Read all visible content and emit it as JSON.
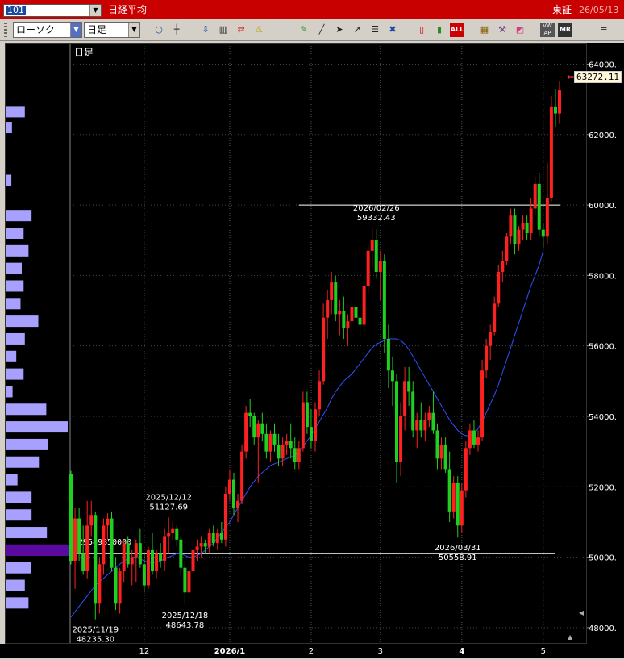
{
  "titlebar": {
    "code": "101",
    "index_name": "日経平均",
    "exchange": "東証",
    "date": "26/05/13"
  },
  "toolbar": {
    "chart_type": "ローソク",
    "period": "日足",
    "icons": [
      "zoom-icon",
      "crosshair-icon",
      "download-icon",
      "bar-mode-icon",
      "compare-icon",
      "alert-icon",
      "pen-icon",
      "draw-line-icon",
      "pointer-icon",
      "arrow-icon",
      "list-icon",
      "trash-icon",
      "candle-red-icon",
      "candle-green-icon",
      "all-icon",
      "pattern-icon",
      "tools-icon",
      "color-icon",
      "vwap-icon",
      "mr-icon",
      "settings-icon"
    ],
    "all_label": "ALL",
    "vwap_label": "VW AP",
    "mr_label": "MR"
  },
  "chart_data": {
    "type": "candlestick",
    "period_label": "日足",
    "last_price": "63272.11",
    "ylim": [
      47700,
      64400
    ],
    "y_ticks": [
      "64000.",
      "62000.",
      "60000.",
      "58000.",
      "56000.",
      "54000.",
      "52000.",
      "50000.",
      "48000."
    ],
    "y_tick_values": [
      64000,
      62000,
      60000,
      58000,
      56000,
      54000,
      52000,
      50000,
      48000
    ],
    "x_ticks": [
      {
        "label": "12",
        "index": 18
      },
      {
        "label": "2026/1",
        "index": 39,
        "bold": true
      },
      {
        "label": "2",
        "index": 59
      },
      {
        "label": "3",
        "index": 76
      },
      {
        "label": "4",
        "index": 96,
        "bold": true
      },
      {
        "label": "5",
        "index": 116
      }
    ],
    "annotations": [
      {
        "date": "2025/11/19",
        "value": "48235.30",
        "index": 6,
        "price": 48235.3,
        "position": "below"
      },
      {
        "date": "2025/12/12",
        "value": "51127.69",
        "index": 24,
        "price": 51127.69,
        "position": "above"
      },
      {
        "date": "2025/12/18",
        "value": "48643.78",
        "index": 28,
        "price": 48643.78,
        "position": "below"
      },
      {
        "date": "2026/02/26",
        "value": "59332.43",
        "index": 75,
        "price": 59332.43,
        "position": "above"
      },
      {
        "date": "2026/03/31",
        "value": "50558.91",
        "index": 95,
        "price": 50558.91,
        "position": "below"
      }
    ],
    "reference_lines": [
      {
        "price": 60000,
        "from_index": 56,
        "to_index": 120
      },
      {
        "price": 50100,
        "from_index": 0,
        "to_index": 119
      }
    ],
    "volume_profile_label": "29589850000",
    "volume_profile": [
      {
        "price": 62650,
        "value": 0.3
      },
      {
        "price": 62200,
        "value": 0.09
      },
      {
        "price": 60700,
        "value": 0.08
      },
      {
        "price": 59700,
        "value": 0.41
      },
      {
        "price": 59200,
        "value": 0.28
      },
      {
        "price": 58700,
        "value": 0.36
      },
      {
        "price": 58200,
        "value": 0.25
      },
      {
        "price": 57700,
        "value": 0.28
      },
      {
        "price": 57200,
        "value": 0.23
      },
      {
        "price": 56700,
        "value": 0.52
      },
      {
        "price": 56200,
        "value": 0.3
      },
      {
        "price": 55700,
        "value": 0.16
      },
      {
        "price": 55200,
        "value": 0.28
      },
      {
        "price": 54700,
        "value": 0.1
      },
      {
        "price": 54200,
        "value": 0.65
      },
      {
        "price": 53700,
        "value": 1.0
      },
      {
        "price": 53200,
        "value": 0.68
      },
      {
        "price": 52700,
        "value": 0.53
      },
      {
        "price": 52200,
        "value": 0.18
      },
      {
        "price": 51700,
        "value": 0.41
      },
      {
        "price": 51200,
        "value": 0.41
      },
      {
        "price": 50700,
        "value": 0.66
      },
      {
        "price": 50200,
        "value": 1.0,
        "highlight": true
      },
      {
        "price": 49700,
        "value": 0.4
      },
      {
        "price": 49200,
        "value": 0.3
      },
      {
        "price": 48700,
        "value": 0.36
      }
    ],
    "candles": [
      [
        52350,
        52450,
        49800,
        49900
      ],
      [
        49900,
        51400,
        49100,
        51100
      ],
      [
        51100,
        51400,
        49900,
        50100
      ],
      [
        50100,
        50900,
        49500,
        49600
      ],
      [
        49600,
        51600,
        49400,
        50900
      ],
      [
        50900,
        51600,
        50600,
        51200
      ],
      [
        51200,
        51300,
        48235,
        48700
      ],
      [
        48700,
        50000,
        48400,
        49800
      ],
      [
        49800,
        51100,
        49500,
        50900
      ],
      [
        50900,
        51250,
        50500,
        51100
      ],
      [
        51100,
        51300,
        49600,
        49700
      ],
      [
        49700,
        50000,
        48500,
        48700
      ],
      [
        48700,
        49700,
        48400,
        49600
      ],
      [
        49600,
        50500,
        49300,
        50400
      ],
      [
        50400,
        50600,
        49700,
        49800
      ],
      [
        49800,
        50200,
        49200,
        50000
      ],
      [
        50000,
        50500,
        49300,
        50400
      ],
      [
        50400,
        50800,
        49700,
        49800
      ],
      [
        49800,
        50100,
        49000,
        49200
      ],
      [
        49200,
        50300,
        49100,
        50200
      ],
      [
        50200,
        50700,
        49500,
        49600
      ],
      [
        49600,
        50200,
        49400,
        50100
      ],
      [
        50100,
        50400,
        49700,
        49900
      ],
      [
        49900,
        50800,
        49600,
        50600
      ],
      [
        50600,
        51128,
        50100,
        50700
      ],
      [
        50700,
        51000,
        50500,
        50800
      ],
      [
        50800,
        50900,
        50300,
        50500
      ],
      [
        50500,
        50600,
        49500,
        49700
      ],
      [
        49700,
        49900,
        48644,
        49000
      ],
      [
        49000,
        49800,
        48800,
        49600
      ],
      [
        49600,
        50300,
        49300,
        50200
      ],
      [
        50200,
        50500,
        49900,
        50300
      ],
      [
        50300,
        50600,
        50000,
        50400
      ],
      [
        50400,
        50500,
        50100,
        50300
      ],
      [
        50300,
        50800,
        50100,
        50700
      ],
      [
        50700,
        50900,
        50300,
        50400
      ],
      [
        50400,
        50800,
        50200,
        50700
      ],
      [
        50700,
        51000,
        50400,
        50500
      ],
      [
        50500,
        52000,
        50300,
        51800
      ],
      [
        51800,
        52500,
        51600,
        52200
      ],
      [
        52200,
        52400,
        51200,
        51400
      ],
      [
        51400,
        51800,
        51000,
        51600
      ],
      [
        51600,
        53200,
        51500,
        53000
      ],
      [
        53000,
        54300,
        52800,
        54100
      ],
      [
        54100,
        54500,
        53700,
        54000
      ],
      [
        54000,
        54100,
        53200,
        53400
      ],
      [
        53400,
        53900,
        52100,
        53800
      ],
      [
        53800,
        54100,
        53300,
        53500
      ],
      [
        53500,
        53800,
        52800,
        53000
      ],
      [
        53000,
        53600,
        52700,
        53500
      ],
      [
        53500,
        53800,
        53000,
        53200
      ],
      [
        53200,
        53500,
        52600,
        52800
      ],
      [
        52800,
        53400,
        52600,
        53200
      ],
      [
        53200,
        53500,
        52900,
        53300
      ],
      [
        53300,
        53800,
        52800,
        53100
      ],
      [
        53100,
        53400,
        52500,
        52700
      ],
      [
        52700,
        53300,
        52500,
        53100
      ],
      [
        53100,
        54700,
        53000,
        54400
      ],
      [
        54400,
        54700,
        53500,
        53700
      ],
      [
        53700,
        54200,
        53100,
        53300
      ],
      [
        53300,
        54400,
        53000,
        54200
      ],
      [
        54200,
        55300,
        54000,
        55000
      ],
      [
        55000,
        57200,
        54900,
        56800
      ],
      [
        56800,
        57600,
        56200,
        57300
      ],
      [
        57300,
        58100,
        56900,
        57800
      ],
      [
        57800,
        58000,
        56700,
        56900
      ],
      [
        56900,
        57300,
        56300,
        57000
      ],
      [
        57000,
        57400,
        56200,
        56500
      ],
      [
        56500,
        56900,
        56000,
        56700
      ],
      [
        56700,
        57300,
        56300,
        57100
      ],
      [
        57100,
        57600,
        56600,
        56800
      ],
      [
        56800,
        57200,
        56300,
        56600
      ],
      [
        56600,
        58000,
        56400,
        57700
      ],
      [
        57700,
        58900,
        57500,
        58700
      ],
      [
        58700,
        59332,
        58200,
        59000
      ],
      [
        59000,
        59300,
        57900,
        58100
      ],
      [
        58100,
        58700,
        57300,
        58400
      ],
      [
        58400,
        58600,
        55800,
        56200
      ],
      [
        56200,
        56600,
        54800,
        55300
      ],
      [
        55300,
        55700,
        54300,
        55000
      ],
      [
        55000,
        55200,
        52100,
        52700
      ],
      [
        52700,
        54400,
        52300,
        54000
      ],
      [
        54000,
        55400,
        53600,
        55000
      ],
      [
        55000,
        55400,
        54300,
        54700
      ],
      [
        54700,
        55000,
        53400,
        53600
      ],
      [
        53600,
        54100,
        53100,
        53900
      ],
      [
        53900,
        54400,
        53400,
        53600
      ],
      [
        53600,
        54100,
        53300,
        53900
      ],
      [
        53900,
        54300,
        53700,
        54100
      ],
      [
        54100,
        54700,
        53500,
        53600
      ],
      [
        53600,
        53800,
        52500,
        52800
      ],
      [
        52800,
        53400,
        52500,
        53200
      ],
      [
        53200,
        53400,
        52400,
        52500
      ],
      [
        52500,
        53000,
        51000,
        51300
      ],
      [
        51300,
        52300,
        51100,
        52100
      ],
      [
        52100,
        52300,
        50559,
        50900
      ],
      [
        50900,
        52100,
        50700,
        51900
      ],
      [
        51900,
        53300,
        51700,
        53100
      ],
      [
        53100,
        53800,
        52900,
        53600
      ],
      [
        53600,
        53900,
        53100,
        53200
      ],
      [
        53200,
        53600,
        53000,
        53400
      ],
      [
        53400,
        55600,
        53300,
        55300
      ],
      [
        55300,
        56200,
        55100,
        56000
      ],
      [
        56000,
        56600,
        55600,
        56400
      ],
      [
        56400,
        57400,
        56300,
        57200
      ],
      [
        57200,
        58300,
        57100,
        58100
      ],
      [
        58100,
        58700,
        57800,
        58400
      ],
      [
        58400,
        59200,
        58300,
        59100
      ],
      [
        59100,
        59900,
        58900,
        59700
      ],
      [
        59700,
        59900,
        58600,
        58900
      ],
      [
        58900,
        59400,
        58700,
        59300
      ],
      [
        59300,
        59700,
        59000,
        59500
      ],
      [
        59500,
        59700,
        59000,
        59200
      ],
      [
        59200,
        60200,
        59000,
        59900
      ],
      [
        59900,
        60800,
        59700,
        60600
      ],
      [
        60600,
        60900,
        59100,
        59300
      ],
      [
        59300,
        59500,
        58800,
        59100
      ],
      [
        59100,
        61200,
        58900,
        60200
      ],
      [
        60200,
        63100,
        60100,
        62800
      ],
      [
        62800,
        63300,
        62200,
        62600
      ],
      [
        62600,
        63500,
        62300,
        63272
      ]
    ],
    "ma": [
      48300,
      48450,
      48600,
      48750,
      48900,
      49050,
      49200,
      49300,
      49400,
      49500,
      49600,
      49700,
      49800,
      49900,
      49950,
      50000,
      50000,
      49950,
      49900,
      49850,
      49850,
      49850,
      49900,
      49950,
      50000,
      50050,
      50100,
      50100,
      50050,
      50000,
      50000,
      50050,
      50100,
      50200,
      50300,
      50400,
      50550,
      50700,
      50850,
      51000,
      51200,
      51400,
      51600,
      51800,
      52000,
      52150,
      52300,
      52400,
      52500,
      52600,
      52650,
      52700,
      52750,
      52800,
      52850,
      52900,
      53000,
      53150,
      53300,
      53450,
      53650,
      53850,
      54050,
      54250,
      54500,
      54700,
      54850,
      55000,
      55100,
      55200,
      55350,
      55500,
      55650,
      55800,
      55950,
      56050,
      56100,
      56150,
      56200,
      56200,
      56200,
      56150,
      56050,
      55900,
      55700,
      55500,
      55300,
      55100,
      54900,
      54700,
      54500,
      54300,
      54100,
      53900,
      53750,
      53600,
      53500,
      53450,
      53450,
      53500,
      53650,
      53850,
      54100,
      54350,
      54600,
      54900,
      55250,
      55600,
      55950,
      56300,
      56650,
      57000,
      57350,
      57700,
      58000,
      58300,
      58700
    ]
  }
}
